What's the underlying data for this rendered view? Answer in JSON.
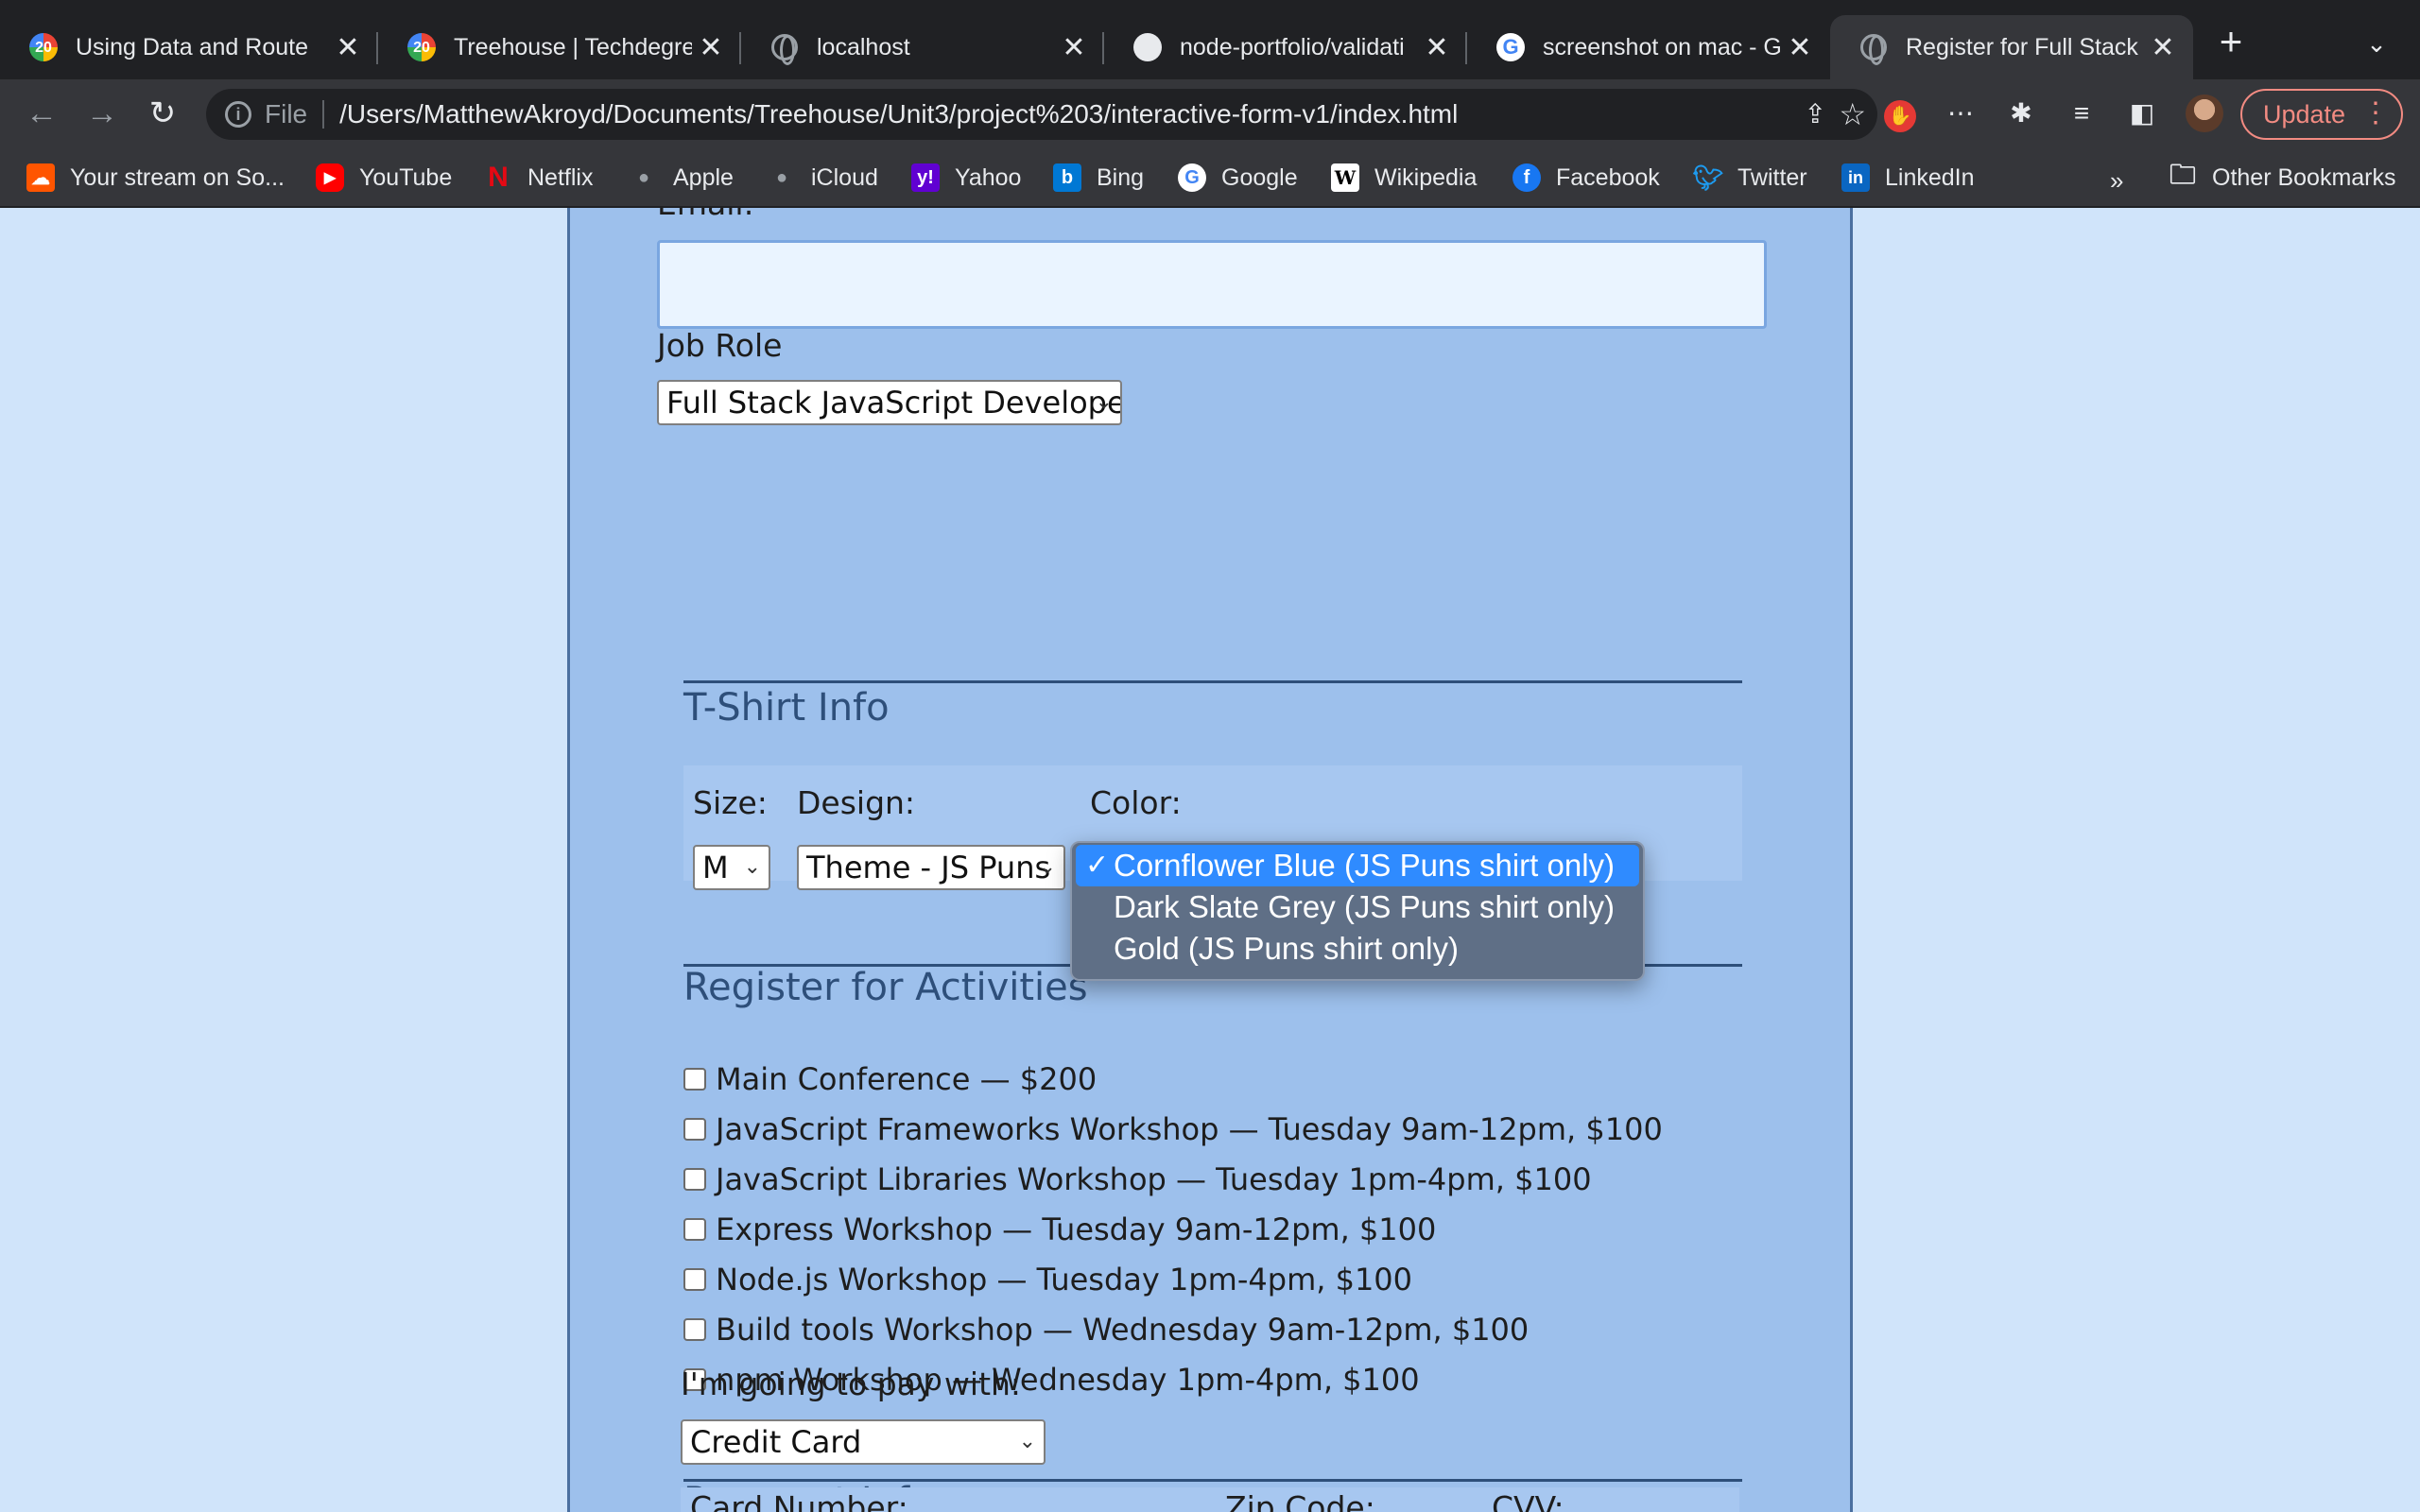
{
  "browser": {
    "tabs": [
      {
        "title": "Using Data and Route",
        "favicon": "treehouse-badge-icon",
        "badge": "20"
      },
      {
        "title": "Treehouse | Techdegre",
        "favicon": "treehouse-badge-icon",
        "badge": "20"
      },
      {
        "title": "localhost",
        "favicon": "globe-icon"
      },
      {
        "title": "node-portfolio/validati",
        "favicon": "github-icon"
      },
      {
        "title": "screenshot on mac - G",
        "favicon": "google-icon"
      },
      {
        "title": "Register for Full Stack",
        "favicon": "globe-icon",
        "active": true
      }
    ],
    "address": {
      "scheme_label": "File",
      "url": "/Users/MatthewAkroyd/Documents/Treehouse/Unit3/project%203/interactive-form-v1/index.html"
    },
    "update_label": "Update",
    "bookmarks": [
      {
        "label": "Your stream on So...",
        "icon": "soundcloud-icon",
        "color": "#ff5500"
      },
      {
        "label": "YouTube",
        "icon": "youtube-icon",
        "color": "#ff0000"
      },
      {
        "label": "Netflix",
        "icon": "netflix-icon",
        "color": "#e50914"
      },
      {
        "label": "Apple",
        "icon": "apple-icon",
        "color": "#9aa0a6"
      },
      {
        "label": "iCloud",
        "icon": "apple-icon",
        "color": "#9aa0a6"
      },
      {
        "label": "Yahoo",
        "icon": "yahoo-icon",
        "color": "#6001d2"
      },
      {
        "label": "Bing",
        "icon": "bing-icon",
        "color": "#0078d4"
      },
      {
        "label": "Google",
        "icon": "google-icon",
        "color": "#ffffff"
      },
      {
        "label": "Wikipedia",
        "icon": "wikipedia-icon",
        "color": "#ffffff"
      },
      {
        "label": "Facebook",
        "icon": "facebook-icon",
        "color": "#1877f2"
      },
      {
        "label": "Twitter",
        "icon": "twitter-icon",
        "color": "#1d9bf0"
      },
      {
        "label": "LinkedIn",
        "icon": "linkedin-icon",
        "color": "#0a66c2"
      }
    ],
    "more_bookmarks": "»",
    "other_bookmarks": "Other Bookmarks"
  },
  "form": {
    "email_label": "Email:",
    "job_role_label": "Job Role",
    "job_role_value": "Full Stack JavaScript Developer",
    "tshirt": {
      "title": "T-Shirt Info",
      "size_label": "Size:",
      "size_value": "M",
      "design_label": "Design:",
      "design_value": "Theme - JS Puns",
      "color_label": "Color:",
      "color_options": [
        "Cornflower Blue (JS Puns shirt only)",
        "Dark Slate Grey (JS Puns shirt only)",
        "Gold (JS Puns shirt only)"
      ],
      "color_selected_index": 0
    },
    "activities": {
      "title": "Register for Activities",
      "items": [
        "Main Conference — $200",
        "JavaScript Frameworks Workshop — Tuesday 9am-12pm, $100",
        "JavaScript Libraries Workshop — Tuesday 1pm-4pm, $100",
        "Express Workshop — Tuesday 9am-12pm, $100",
        "Node.js Workshop — Tuesday 1pm-4pm, $100",
        "Build tools Workshop — Wednesday 9am-12pm, $100",
        "npm Workshop — Wednesday 1pm-4pm, $100"
      ]
    },
    "payment": {
      "title": "Payment Info",
      "pay_with_label": "I'm going to pay with:",
      "pay_with_value": "Credit Card",
      "card_number_label": "Card Number:",
      "zip_label": "Zip Code:",
      "cvv_label": "CVV:"
    }
  },
  "colors": {
    "page_bg": "#d0e4fa",
    "form_bg": "#9dc0ec",
    "section_title": "#2e4f7a",
    "dropdown_selected": "#2f8bff"
  }
}
